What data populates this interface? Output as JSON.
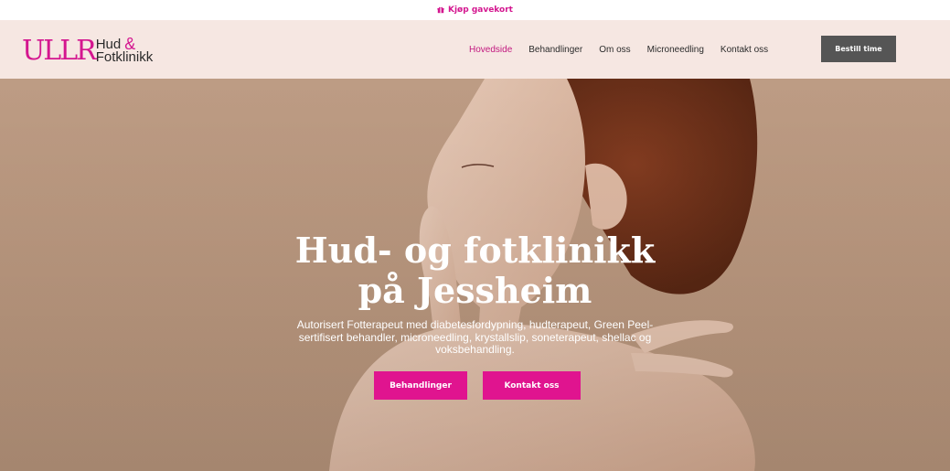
{
  "topbar": {
    "gift_label": "Kjøp gavekort",
    "gift_icon": "gift-icon",
    "accent_color": "#d4168f"
  },
  "header": {
    "logo": {
      "main": "ULLR",
      "line1": "Hud",
      "ampersand": "&",
      "line2": "Fotklinikk"
    },
    "nav": [
      {
        "label": "Hovedside",
        "active": true
      },
      {
        "label": "Behandlinger",
        "active": false
      },
      {
        "label": "Om oss",
        "active": false
      },
      {
        "label": "Microneedling",
        "active": false
      },
      {
        "label": "Kontakt oss",
        "active": false
      }
    ],
    "book_button": "Bestill time",
    "background_color": "#f6e7e2"
  },
  "hero": {
    "title": "Hud- og fotklinikk på Jessheim",
    "subtitle": "Autorisert Fotterapeut med diabetesfordypning, hudterapeut, Green Peel-sertifisert behandler, microneedling, krystallslip, soneterapeut, shellac og voksbehandling.",
    "primary_button": "Behandlinger",
    "secondary_button": "Kontakt oss",
    "button_color": "#e0148f"
  }
}
